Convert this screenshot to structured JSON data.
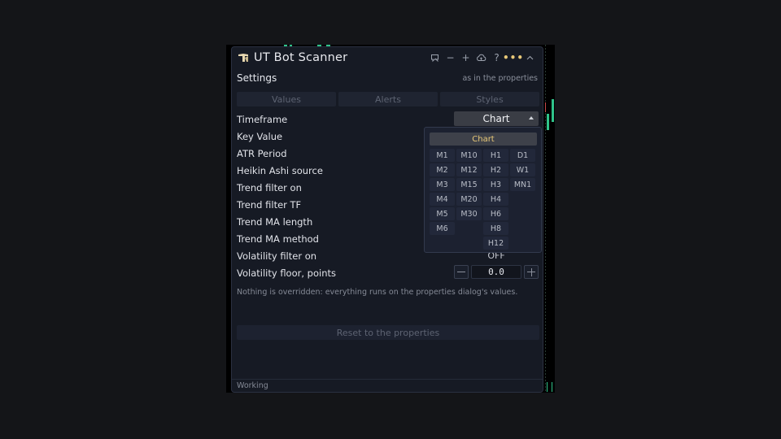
{
  "window": {
    "title": "UT Bot Scanner",
    "icons": [
      "app-logo-icon",
      "comment-icon",
      "minimize-icon",
      "plus-icon",
      "cloud-icon",
      "help-icon",
      "more-icon",
      "collapse-icon"
    ],
    "toolbar": {
      "minus": "−",
      "plus": "+",
      "help": "?",
      "dots": "•••"
    }
  },
  "settings": {
    "label": "Settings",
    "note": "as in the properties"
  },
  "tabs": [
    {
      "label": "Values"
    },
    {
      "label": "Alerts"
    },
    {
      "label": "Styles"
    }
  ],
  "rows": [
    {
      "label": "Timeframe"
    },
    {
      "label": "Key Value"
    },
    {
      "label": "ATR Period"
    },
    {
      "label": "Heikin Ashi source"
    },
    {
      "label": "Trend filter on"
    },
    {
      "label": "Trend filter TF"
    },
    {
      "label": "Trend MA length"
    },
    {
      "label": "Trend MA method"
    },
    {
      "label": "Volatility filter on"
    },
    {
      "label": "Volatility floor, points"
    }
  ],
  "timeframe": {
    "selected": "Chart",
    "popup": {
      "chart_option": "Chart",
      "options": [
        "M1",
        "M10",
        "H1",
        "D1",
        "M2",
        "M12",
        "H2",
        "W1",
        "M3",
        "M15",
        "H3",
        "MN1",
        "M4",
        "M20",
        "H4",
        "M5",
        "M30",
        "H6",
        "M6",
        "H8",
        "H12"
      ]
    }
  },
  "volatility_filter": {
    "value": "OFF"
  },
  "volatility_floor": {
    "value": "0.0"
  },
  "info_text": "Nothing is overridden: everything runs on the properties dialog's values.",
  "reset_button": "Reset to the properties",
  "status": "Working",
  "colors": {
    "accent": "#e8c878",
    "panel_bg": "#161a24",
    "up_candle": "#2fc38a",
    "down_candle": "#c84747"
  }
}
